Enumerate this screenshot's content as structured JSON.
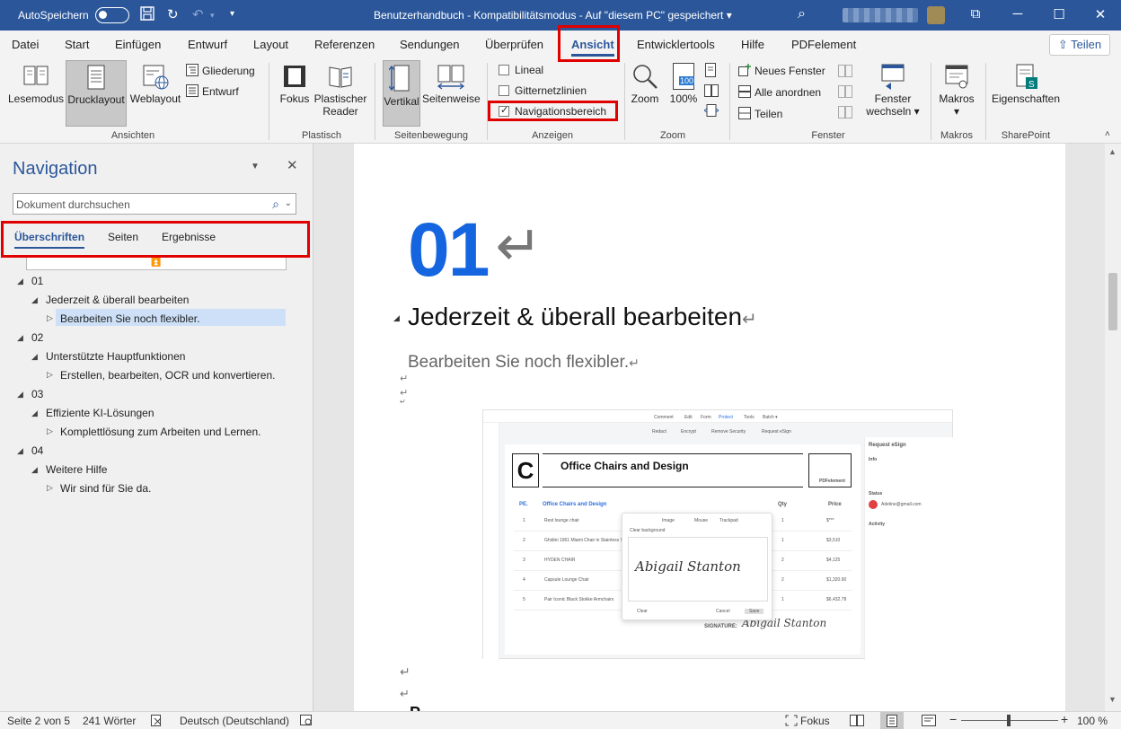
{
  "titlebar": {
    "autosave_label": "AutoSpeichern",
    "doc_title": "Benutzerhandbuch  -  Kompatibilitätsmodus  -  Auf \"diesem PC\" gespeichert  ▾",
    "minimize": "─",
    "restore": "⧉",
    "maximize": "☐",
    "close": "✕"
  },
  "menu_tabs": [
    "Datei",
    "Start",
    "Einfügen",
    "Entwurf",
    "Layout",
    "Referenzen",
    "Sendungen",
    "Überprüfen",
    "Ansicht",
    "Entwicklertools",
    "Hilfe",
    "PDFelement"
  ],
  "active_tab": "Ansicht",
  "share_label": "Teilen",
  "ribbon": {
    "ansichten": {
      "label": "Ansichten",
      "lesemodus": "Lesemodus",
      "drucklayout": "Drucklayout",
      "weblayout": "Weblayout",
      "gliederung": "Gliederung",
      "entwurf": "Entwurf"
    },
    "plastisch": {
      "label": "Plastisch",
      "fokus": "Fokus",
      "reader_line1": "Plastischer",
      "reader_line2": "Reader"
    },
    "seitenbewegung": {
      "label": "Seitenbewegung",
      "vertikal": "Vertikal",
      "seitenweise": "Seitenweise"
    },
    "anzeigen": {
      "label": "Anzeigen",
      "lineal": "Lineal",
      "gitternetzlinien": "Gitternetzlinien",
      "navigationsbereich": "Navigationsbereich",
      "lineal_checked": false,
      "gitter_checked": false,
      "nav_checked": true
    },
    "zoom": {
      "label": "Zoom",
      "zoom": "Zoom",
      "percent": "100%",
      "badge": "100"
    },
    "fenster": {
      "label": "Fenster",
      "neues_fenster": "Neues Fenster",
      "alle_anordnen": "Alle anordnen",
      "teilen": "Teilen",
      "wechseln_line1": "Fenster",
      "wechseln_line2": "wechseln ▾"
    },
    "makros": {
      "label": "Makros",
      "makros": "Makros",
      "dd": "▾"
    },
    "sharepoint": {
      "label": "SharePoint",
      "eigenschaften": "Eigenschaften"
    }
  },
  "navigation": {
    "title": "Navigation",
    "search_placeholder": "Dokument durchsuchen",
    "tabs": [
      "Überschriften",
      "Seiten",
      "Ergebnisse"
    ],
    "tree": [
      "01",
      "Jederzeit & überall bearbeiten",
      "Bearbeiten Sie noch flexibler.",
      "02",
      "Unterstützte Hauptfunktionen",
      "Erstellen, bearbeiten, OCR und konvertieren.",
      "03",
      "Effiziente KI-Lösungen",
      "Komplettlösung zum Arbeiten und Lernen.",
      "04",
      "Weitere Hilfe",
      "Wir sind für Sie da."
    ]
  },
  "document": {
    "big_number": "01",
    "heading": "Jederzeit & überall bearbeiten",
    "subheading": "Bearbeiten Sie noch flexibler.",
    "return_mark": "↵",
    "bottom_partial": "P"
  },
  "embedded": {
    "menu": [
      "Comment",
      "Edit",
      "Form",
      "Protect",
      "Tools",
      "Batch ▾"
    ],
    "tools": [
      "Redact",
      "Encrypt",
      "Remove Security",
      "Request eSign"
    ],
    "company": "Office Chairs and Design",
    "brand": "PDFelement",
    "table_title": "Office Chairs and Design",
    "col_pe": "PE.",
    "col_qty": "Qty",
    "col_price": "Price",
    "rows": [
      {
        "n": "1",
        "item": "Rest lounge chair",
        "qty": "1",
        "price": "$***"
      },
      {
        "n": "2",
        "item": "Ghidini 1961 Miami Chair in Stainless S",
        "qty": "1",
        "price": "$3,510"
      },
      {
        "n": "3",
        "item": "HYDEN CHAIR",
        "qty": "2",
        "price": "$4,125"
      },
      {
        "n": "4",
        "item": "Capsule Lounge Chair",
        "qty": "2",
        "price": "$1,320.90"
      },
      {
        "n": "5",
        "item": "Pair Iconic Black Stokke Armchairs",
        "qty": "1",
        "price": "$6,432.78"
      }
    ],
    "dialog_tabs": [
      "Image",
      "Mouse",
      "Trackpad"
    ],
    "dialog_clear": "Clear background",
    "dialog_btn_clear": "Clear",
    "dialog_btn_cancel": "Cancel",
    "dialog_btn_save": "Save",
    "signature": "Abigail Stanton",
    "signature_label": "SIGNATURE:",
    "side_title": "Request eSign",
    "side_info": "Info",
    "side_status": "Status",
    "side_activity": "Activity",
    "side_user": "Adeline@gmail.com"
  },
  "status": {
    "page": "Seite 2 von 5",
    "words": "241 Wörter",
    "language": "Deutsch (Deutschland)",
    "focus": "Fokus",
    "zoom": "100 %",
    "minus": "−",
    "plus": "+"
  }
}
